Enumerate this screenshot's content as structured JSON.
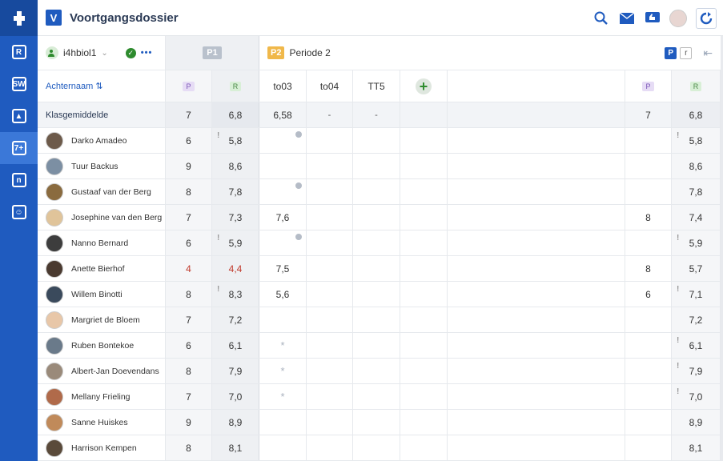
{
  "app": {
    "title": "Voortgangsdossier",
    "logo_letter": "V"
  },
  "nav": {
    "items": [
      {
        "name": "roster-icon",
        "glyph": "R"
      },
      {
        "name": "studiewijzer-icon",
        "glyph": "SW"
      },
      {
        "name": "inbox-icon",
        "glyph": "▲"
      },
      {
        "name": "grades-icon",
        "glyph": "7+"
      },
      {
        "name": "notes-icon",
        "glyph": "n"
      },
      {
        "name": "students-icon",
        "glyph": "☺"
      }
    ]
  },
  "colors": {
    "brand": "#1f5bbf",
    "low_grade": "#c0392b",
    "p2_badge": "#f0b84a"
  },
  "toolbar": {
    "group": "i4hbiol1",
    "more": "•••",
    "p1_badge": "P1",
    "p2_badge": "P2",
    "periode_label": "Periode 2",
    "p_toggle": "P",
    "r_toggle": "r"
  },
  "columns": {
    "sort_label": "Achternaam ⇅",
    "p": "P",
    "r": "R",
    "to03": "to03",
    "to04": "to04",
    "tt5": "TT5",
    "add": "+"
  },
  "klas": {
    "label": "Klasgemiddelde",
    "p1p": "7",
    "p1r": "6,8",
    "to03": "6,58",
    "to04": "-",
    "tt5": "-",
    "p2p": "7",
    "p2r": "6,8"
  },
  "students": [
    {
      "name": "Darko Amadeo",
      "p1p": "6",
      "p1r": "5,8",
      "to03": "",
      "p2p": "",
      "p2r": "5,8",
      "excl1": "!",
      "excl2": "!",
      "dot": true,
      "low": false
    },
    {
      "name": "Tuur Backus",
      "p1p": "9",
      "p1r": "8,6",
      "to03": "",
      "p2p": "",
      "p2r": "8,6",
      "excl1": "",
      "excl2": "",
      "dot": false,
      "low": false
    },
    {
      "name": "Gustaaf van der Berg",
      "p1p": "8",
      "p1r": "7,8",
      "to03": "",
      "p2p": "",
      "p2r": "7,8",
      "excl1": "",
      "excl2": "",
      "dot": true,
      "low": false
    },
    {
      "name": "Josephine van den Berg",
      "p1p": "7",
      "p1r": "7,3",
      "to03": "7,6",
      "p2p": "8",
      "p2r": "7,4",
      "excl1": "",
      "excl2": "",
      "dot": false,
      "low": false
    },
    {
      "name": "Nanno Bernard",
      "p1p": "6",
      "p1r": "5,9",
      "to03": "",
      "p2p": "",
      "p2r": "5,9",
      "excl1": "!",
      "excl2": "!",
      "dot": true,
      "low": false
    },
    {
      "name": "Anette Bierhof",
      "p1p": "4",
      "p1r": "4,4",
      "to03": "7,5",
      "p2p": "8",
      "p2r": "5,7",
      "excl1": "",
      "excl2": "",
      "dot": false,
      "low": true
    },
    {
      "name": "Willem Binotti",
      "p1p": "8",
      "p1r": "8,3",
      "to03": "5,6",
      "p2p": "6",
      "p2r": "7,1",
      "excl1": "!",
      "excl2": "!",
      "dot": false,
      "low": false
    },
    {
      "name": "Margriet de Bloem",
      "p1p": "7",
      "p1r": "7,2",
      "to03": "",
      "p2p": "",
      "p2r": "7,2",
      "excl1": "",
      "excl2": "",
      "dot": false,
      "low": false
    },
    {
      "name": "Ruben Bontekoe",
      "p1p": "6",
      "p1r": "6,1",
      "to03": "*",
      "p2p": "",
      "p2r": "6,1",
      "excl1": "",
      "excl2": "!",
      "dot": false,
      "low": false
    },
    {
      "name": "Albert-Jan Doevendans",
      "p1p": "8",
      "p1r": "7,9",
      "to03": "*",
      "p2p": "",
      "p2r": "7,9",
      "excl1": "",
      "excl2": "!",
      "dot": false,
      "low": false
    },
    {
      "name": "Mellany Frieling",
      "p1p": "7",
      "p1r": "7,0",
      "to03": "*",
      "p2p": "",
      "p2r": "7,0",
      "excl1": "",
      "excl2": "!",
      "dot": false,
      "low": false
    },
    {
      "name": "Sanne Huiskes",
      "p1p": "9",
      "p1r": "8,9",
      "to03": "",
      "p2p": "",
      "p2r": "8,9",
      "excl1": "",
      "excl2": "",
      "dot": false,
      "low": false
    },
    {
      "name": "Harrison Kempen",
      "p1p": "8",
      "p1r": "8,1",
      "to03": "",
      "p2p": "",
      "p2r": "8,1",
      "excl1": "",
      "excl2": "",
      "dot": false,
      "low": false
    }
  ]
}
